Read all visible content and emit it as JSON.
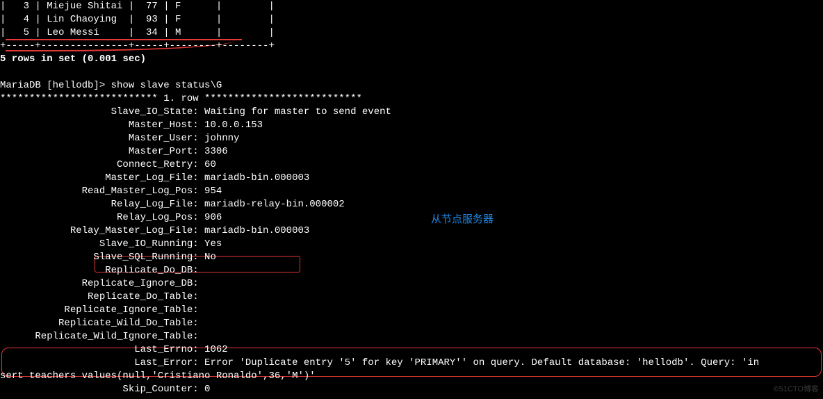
{
  "table": {
    "rows": [
      {
        "line": "|   3 | Miejue Shitai |  77 | F      |        |"
      },
      {
        "line": "|   4 | Lin Chaoying  |  93 | F      |        |"
      },
      {
        "line": "|   5 | Leo Messi     |  34 | M      |        |"
      }
    ],
    "sep": "+-----+---------------+-----+--------+--------+",
    "footer": "5 rows in set (0.001 sec)"
  },
  "prompt": "MariaDB [hellodb]> show slave status\\G",
  "row_header": "*************************** 1. row ***************************",
  "status": [
    {
      "k": "Slave_IO_State",
      "v": "Waiting for master to send event"
    },
    {
      "k": "Master_Host",
      "v": "10.0.0.153"
    },
    {
      "k": "Master_User",
      "v": "johnny"
    },
    {
      "k": "Master_Port",
      "v": "3306"
    },
    {
      "k": "Connect_Retry",
      "v": "60"
    },
    {
      "k": "Master_Log_File",
      "v": "mariadb-bin.000003"
    },
    {
      "k": "Read_Master_Log_Pos",
      "v": "954"
    },
    {
      "k": "Relay_Log_File",
      "v": "mariadb-relay-bin.000002"
    },
    {
      "k": "Relay_Log_Pos",
      "v": "906"
    },
    {
      "k": "Relay_Master_Log_File",
      "v": "mariadb-bin.000003"
    },
    {
      "k": "Slave_IO_Running",
      "v": "Yes"
    },
    {
      "k": "Slave_SQL_Running",
      "v": "No"
    },
    {
      "k": "Replicate_Do_DB",
      "v": ""
    },
    {
      "k": "Replicate_Ignore_DB",
      "v": ""
    },
    {
      "k": "Replicate_Do_Table",
      "v": ""
    },
    {
      "k": "Replicate_Ignore_Table",
      "v": ""
    },
    {
      "k": "Replicate_Wild_Do_Table",
      "v": ""
    },
    {
      "k": "Replicate_Wild_Ignore_Table",
      "v": ""
    },
    {
      "k": "Last_Errno",
      "v": "1062"
    }
  ],
  "last_error": {
    "k": "Last_Error",
    "l1": "Error 'Duplicate entry '5' for key 'PRIMARY'' on query. Default database: 'hellodb'. Query: 'in",
    "l2": "sert teachers values(null,'Cristiano Ronaldo',36,'M')'"
  },
  "skip": {
    "k": "Skip_Counter",
    "v": "0"
  },
  "blue_label": "从节点服务器",
  "watermark": "©51CTO博客",
  "key_col_width": 33
}
